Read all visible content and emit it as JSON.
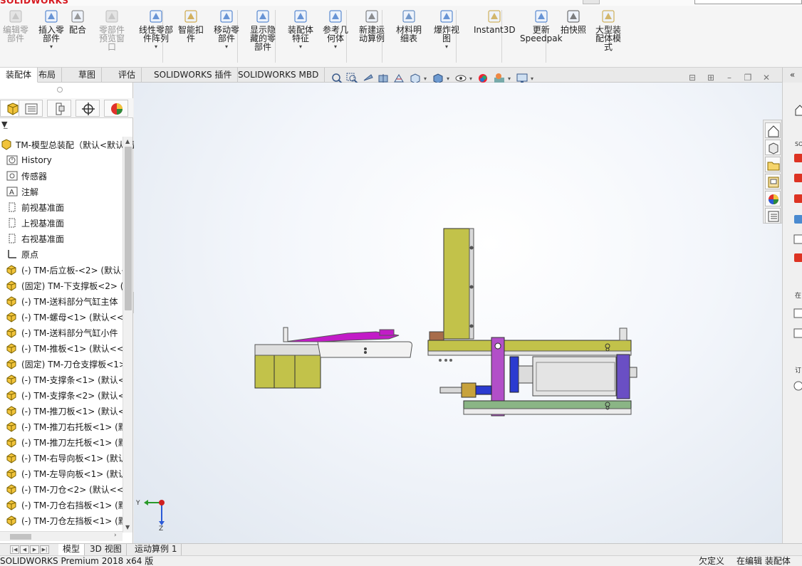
{
  "app": {
    "logo_text": "SOLIDWORKS"
  },
  "ribbon": {
    "buttons": [
      {
        "label": "编辑零\n部件",
        "disabled": true,
        "caret": false
      },
      {
        "label": "插入零\n部件",
        "disabled": false,
        "caret": true
      },
      {
        "label": "配合",
        "disabled": false,
        "caret": false
      },
      {
        "label": "零部件\n预览窗\n口",
        "disabled": true,
        "caret": false
      },
      {
        "label": "线性零部\n件阵列",
        "disabled": false,
        "caret": true
      },
      {
        "label": "智能扣\n件",
        "disabled": false,
        "caret": false
      },
      {
        "label": "移动零\n部件",
        "disabled": false,
        "caret": true
      },
      {
        "label": "显示隐\n藏的零\n部件",
        "disabled": false,
        "caret": false
      },
      {
        "label": "装配体\n特征",
        "disabled": false,
        "caret": true
      },
      {
        "label": "参考几\n何体",
        "disabled": false,
        "caret": true
      },
      {
        "label": "新建运\n动算例",
        "disabled": false,
        "caret": false
      },
      {
        "label": "材料明\n细表",
        "disabled": false,
        "caret": false
      },
      {
        "label": "爆炸视\n图",
        "disabled": false,
        "caret": true
      },
      {
        "label": "Instant3D",
        "disabled": false,
        "caret": false
      },
      {
        "label": "更新\nSpeedpak",
        "disabled": false,
        "caret": false
      },
      {
        "label": "拍快照",
        "disabled": false,
        "caret": false
      },
      {
        "label": "大型装\n配体模\n式",
        "disabled": false,
        "caret": false
      }
    ]
  },
  "tabs": [
    {
      "label": "装配体",
      "active": true
    },
    {
      "label": "布局",
      "active": false
    },
    {
      "label": "草图",
      "active": false
    },
    {
      "label": "评估",
      "active": false
    },
    {
      "label": "SOLIDWORKS 插件",
      "active": false
    },
    {
      "label": "SOLIDWORKS MBD",
      "active": false
    }
  ],
  "feature_manager": {
    "root": "TM-模型总装配（默认<默认_显",
    "items": [
      {
        "label": "History",
        "icon": "history-icon"
      },
      {
        "label": "传感器",
        "icon": "sensor-icon"
      },
      {
        "label": "注解",
        "icon": "annotation-icon"
      },
      {
        "label": "前视基准面",
        "icon": "plane-icon"
      },
      {
        "label": "上视基准面",
        "icon": "plane-icon"
      },
      {
        "label": "右视基准面",
        "icon": "plane-icon"
      },
      {
        "label": "原点",
        "icon": "origin-icon"
      },
      {
        "label": "(-) TM-后立板-<2> (默认<",
        "icon": "part-icon"
      },
      {
        "label": "(固定) TM-下支撑板<2> (",
        "icon": "part-icon"
      },
      {
        "label": "(-) TM-送料部分气缸主体",
        "icon": "part-icon"
      },
      {
        "label": "(-) TM-螺母<1> (默认<<",
        "icon": "part-icon"
      },
      {
        "label": "(-) TM-送料部分气缸小件",
        "icon": "part-icon"
      },
      {
        "label": "(-) TM-推板<1> (默认<<",
        "icon": "part-icon"
      },
      {
        "label": "(固定) TM-刀仓支撑板<1>",
        "icon": "part-icon"
      },
      {
        "label": "(-) TM-支撑条<1> (默认<",
        "icon": "part-icon"
      },
      {
        "label": "(-) TM-支撑条<2> (默认<",
        "icon": "part-icon"
      },
      {
        "label": "(-) TM-推刀板<1> (默认<",
        "icon": "part-icon"
      },
      {
        "label": "(-) TM-推刀右托板<1> (默",
        "icon": "part-icon"
      },
      {
        "label": "(-) TM-推刀左托板<1> (默",
        "icon": "part-icon"
      },
      {
        "label": "(-) TM-右导向板<1> (默认",
        "icon": "part-icon"
      },
      {
        "label": "(-) TM-左导向板<1> (默认",
        "icon": "part-icon"
      },
      {
        "label": "(-) TM-刀仓<2> (默认<<",
        "icon": "part-icon"
      },
      {
        "label": "(-) TM-刀仓右挡板<1> (默",
        "icon": "part-icon"
      },
      {
        "label": "(-) TM-刀仓左挡板<1> (默",
        "icon": "part-icon"
      }
    ]
  },
  "triad": {
    "y": "Y",
    "z": "Z"
  },
  "bottom_tabs": [
    {
      "label": "模型",
      "active": true
    },
    {
      "label": "3D 视图",
      "active": false
    },
    {
      "label": "运动算例 1",
      "active": false
    }
  ],
  "status": {
    "product": "SOLIDWORKS Premium 2018 x64 版",
    "underdefined": "欠定义",
    "editing": "在编辑 装配体"
  },
  "colors": {
    "olive": "#b5b53a",
    "magenta": "#c21cc7",
    "green_plate": "#8ab585",
    "purple": "#6a4fc4",
    "blue_block": "#2b3bd0"
  }
}
